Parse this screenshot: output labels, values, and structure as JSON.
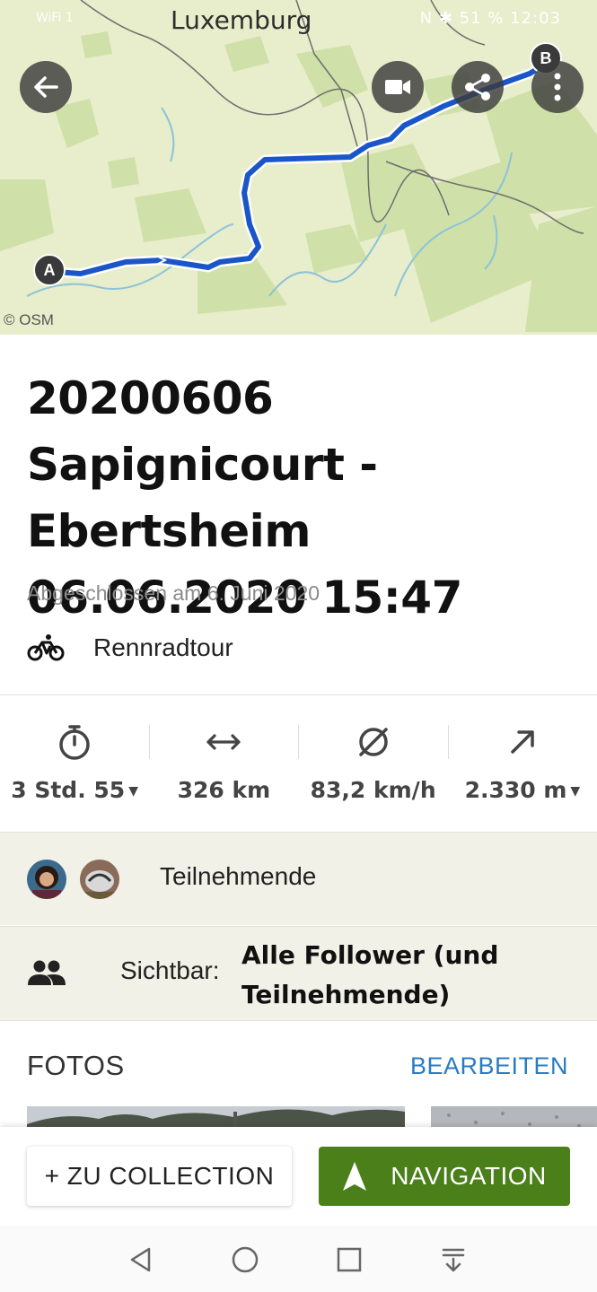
{
  "status_bar": {
    "left_text": "WiFi 1",
    "city_label": "Luxemburg",
    "right_text": "N ✱ 51 % 12:03"
  },
  "map": {
    "attribution": "© OSM",
    "marker_start": "A",
    "marker_end": "B"
  },
  "tour": {
    "title": "20200606 Sapignicourt - Ebertsheim 06.06.2020 15:47",
    "status": "Abgeschlossen am 6. Juni 2020",
    "sport": "Rennradtour"
  },
  "stats": {
    "duration": "3 Std. 55",
    "distance": "326 km",
    "speed": "83,2 km/h",
    "elevation": "2.330 m"
  },
  "participants": {
    "label": "Teilnehmende"
  },
  "visibility": {
    "label": "Sichtbar:",
    "value": "Alle Follower (und Teilnehmende)"
  },
  "photos": {
    "header": "FOTOS",
    "edit_label": "BEARBEITEN"
  },
  "actions": {
    "collection_label": "+ ZU COLLECTION",
    "navigation_label": "NAVIGATION"
  },
  "colors": {
    "route": "#1a56c8",
    "nav_green": "#4a7f1a",
    "link_blue": "#2a7cc0",
    "band_bg": "#f2f1e8",
    "map_bg": "#e5ebc6"
  }
}
